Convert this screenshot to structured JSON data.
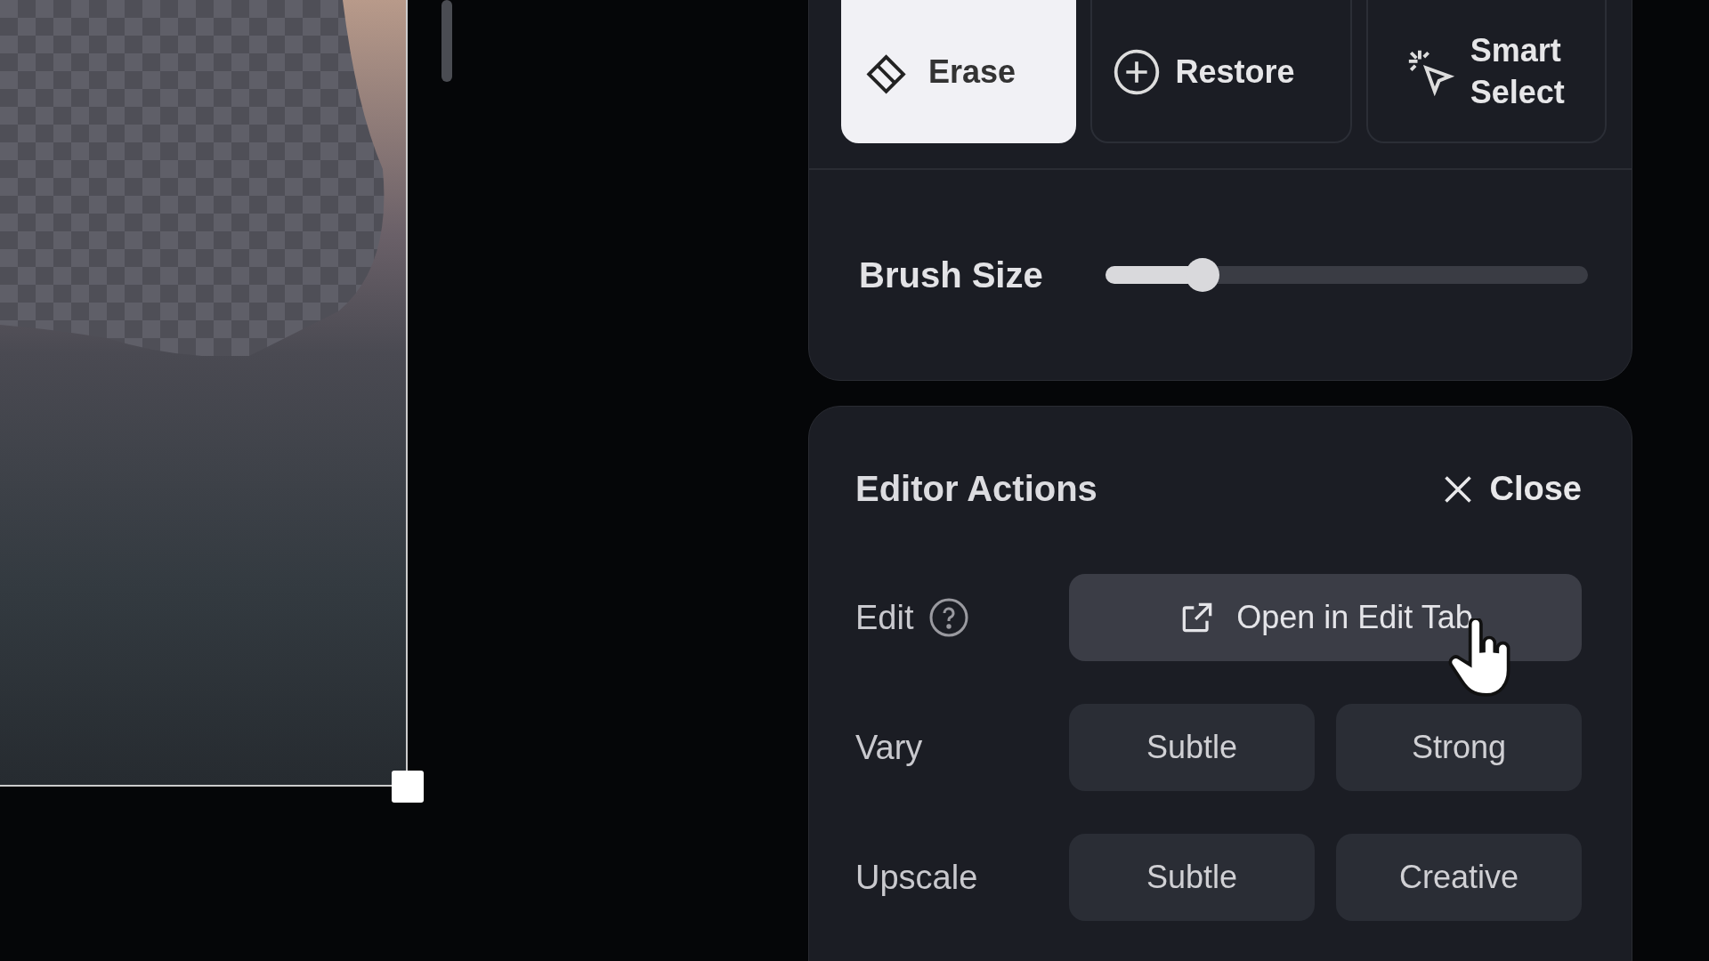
{
  "tools": [
    {
      "kind": "erase",
      "label": "Erase",
      "selected": true
    },
    {
      "kind": "restore",
      "label": "Restore",
      "selected": false
    },
    {
      "kind": "smart",
      "label": "Smart Select",
      "selected": false
    }
  ],
  "brush": {
    "label": "Brush Size",
    "level": 0.18
  },
  "actions": {
    "title": "Editor Actions",
    "close": "Close",
    "rows": [
      {
        "label": "Edit",
        "help": true,
        "buttons": [
          {
            "kind": "open",
            "label": "Open in Edit Tab"
          }
        ]
      },
      {
        "label": "Vary",
        "help": false,
        "buttons": [
          {
            "kind": "plain",
            "label": "Subtle"
          },
          {
            "kind": "plain",
            "label": "Strong"
          }
        ]
      },
      {
        "label": "Upscale",
        "help": false,
        "buttons": [
          {
            "kind": "plain",
            "label": "Subtle"
          },
          {
            "kind": "plain",
            "label": "Creative"
          }
        ]
      }
    ]
  }
}
